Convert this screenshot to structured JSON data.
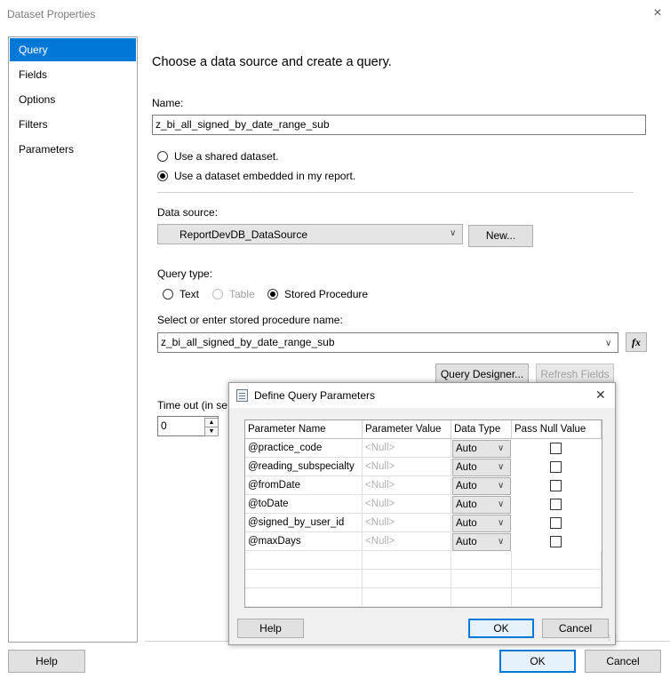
{
  "window": {
    "title": "Dataset Properties",
    "close_icon": "×"
  },
  "nav": {
    "items": [
      {
        "label": "Query",
        "selected": true
      },
      {
        "label": "Fields"
      },
      {
        "label": "Options"
      },
      {
        "label": "Filters"
      },
      {
        "label": "Parameters"
      }
    ]
  },
  "main": {
    "heading": "Choose a data source and create a query.",
    "name_label": "Name:",
    "name_value": "z_bi_all_signed_by_date_range_sub",
    "radio_shared": "Use a shared dataset.",
    "radio_embedded": "Use a dataset embedded in my report.",
    "datasource_label": "Data source:",
    "datasource_value": "ReportDevDB_DataSource",
    "new_button": "New...",
    "query_type_label": "Query type:",
    "qt_text": "Text",
    "qt_table": "Table",
    "qt_stored": "Stored Procedure",
    "sp_label": "Select or enter stored procedure name:",
    "sp_value": "z_bi_all_signed_by_date_range_sub",
    "fx_button": "fx",
    "query_designer_button": "Query Designer...",
    "refresh_fields_button": "Refresh Fields",
    "timeout_label": "Time out (in se",
    "timeout_value": "0"
  },
  "footer": {
    "help": "Help",
    "ok": "OK",
    "cancel": "Cancel"
  },
  "dialog": {
    "title": "Define Query Parameters",
    "close_icon": "✕",
    "columns": [
      "Parameter Name",
      "Parameter Value",
      "Data Type",
      "Pass Null Value"
    ],
    "rows": [
      {
        "name": "@practice_code",
        "value": "<Null>",
        "type": "Auto"
      },
      {
        "name": "@reading_subspecialty",
        "value": "<Null>",
        "type": "Auto"
      },
      {
        "name": "@fromDate",
        "value": "<Null>",
        "type": "Auto"
      },
      {
        "name": "@toDate",
        "value": "<Null>",
        "type": "Auto"
      },
      {
        "name": "@signed_by_user_id",
        "value": "<Null>",
        "type": "Auto"
      },
      {
        "name": "@maxDays",
        "value": "<Null>",
        "type": "Auto"
      }
    ],
    "help": "Help",
    "ok": "OK",
    "cancel": "Cancel"
  }
}
